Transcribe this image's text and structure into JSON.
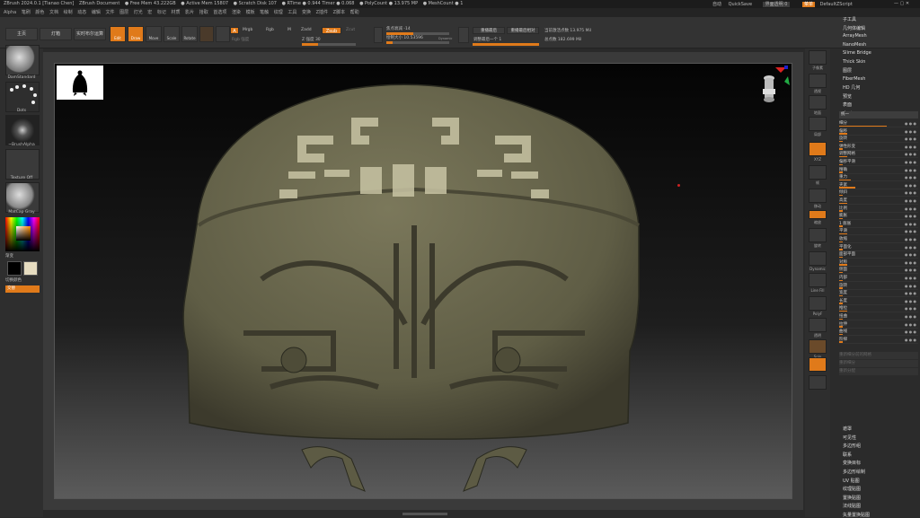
{
  "titlebar": {
    "app": "ZBrush 2024.0.1 [Tianao Chen]",
    "doc": "ZBrush Document",
    "free_mem": "● Free Mem 43.222GB",
    "active_mem": "● Active Mem 15807",
    "scratch": "● Scratch Disk 107",
    "rtime": "● RTime ● 0.944 Timer ● 0.068",
    "polycount": "● PolyCount ● 13.975 MP",
    "meshcount": "● MeshCount ● 1",
    "quicksave": "QuickSave",
    "auto": "自动",
    "transparency": "界面透明 0",
    "menus_btn": "菜单",
    "default_script": "DefaultZScript"
  },
  "menubar": [
    "Alpha",
    "笔刷",
    "颜色",
    "文档",
    "绘制",
    "动态",
    "编辑",
    "文件",
    "图层",
    "灯光",
    "宏",
    "标记",
    "材质",
    "影片",
    "拾取",
    "首选项",
    "渲染",
    "模板",
    "笔触",
    "纹理",
    "工具",
    "变换",
    "Z插件",
    "Z脚本",
    "帮助"
  ],
  "toolbar": {
    "home": "主页",
    "lightbox": "灯箱",
    "live_boolean": "实时布尔运算",
    "edit": "Edit",
    "draw": "Draw",
    "move": "Move",
    "scale": "Scale",
    "rotate": "Rotate",
    "a_label": "A",
    "mrgb": "Mrgb",
    "rgb": "Rgb",
    "m": "M",
    "zadd": "Zadd",
    "zsub": "Zsub",
    "zcut": "Zcut",
    "rgb_intensity": "Rgb 强度",
    "z_intensity": "Z 强度 30",
    "focal_shift": "焦点衰减 -14",
    "draw_size": "绘制大小 10.53596",
    "dynamic": "Dynamic",
    "activepoints": "当前激活点数 13.975 Mil",
    "totalpoints": "总点数 182.699 Mil",
    "replay_last": "重播最后",
    "replay_last_rel": "重播最后相对",
    "adjust_last": "调整最后一个 1"
  },
  "left_shelf": {
    "brush1": "DamStandard",
    "brush2": "Dots",
    "alpha": "~BrushAlpha",
    "texture": "Texture Off",
    "material": "MatCap Gray",
    "color_label": "渐变",
    "switch_color": "切换颜色",
    "alternate": "交替"
  },
  "right_shelf": [
    "子像素",
    "透视",
    "地面",
    "局部",
    "XYZ",
    "帧",
    "移动",
    "缩放",
    "旋转",
    "Dynamic",
    "Line Fill",
    "PolyF",
    "透明",
    "Solo",
    "Xpose"
  ],
  "right_panel": {
    "top_items": [
      "子工具",
      "几何体编辑",
      "ArrayMesh",
      "NanoMesh",
      "Slime Bridge",
      "Thick Skin",
      "图层",
      "FiberMesh",
      "HD 几何",
      "预览",
      "表面",
      "变形"
    ],
    "section": "统一",
    "props": [
      "细分",
      "偏移",
      "旋转",
      "弹性形变",
      "调整网格",
      "偏移平滑",
      "精确",
      "重力",
      "夹紧",
      "倾斜",
      "高度",
      "比例",
      "膨胀",
      "1 膨胀",
      "平滑",
      "收缩",
      "平面化",
      "面部平面",
      "对称",
      "侧面",
      "内部",
      "旋转",
      "宽度",
      "长度",
      "推拉",
      "扭曲",
      "拉伸",
      "曲线",
      "阶梯"
    ],
    "grey_rows": [
      "重新细分前的网格",
      "重新细分",
      "重新分配"
    ],
    "bottom_items": [
      "遮罩",
      "可见性",
      "多边形组",
      "联系",
      "变换目标",
      "多边形绘制",
      "UV 贴图",
      "纹理贴图",
      "置换贴图",
      "法线贴图",
      "矢量置换贴图"
    ]
  },
  "colors": {
    "accent": "#e07a1a",
    "model": "#6c6a4f"
  }
}
